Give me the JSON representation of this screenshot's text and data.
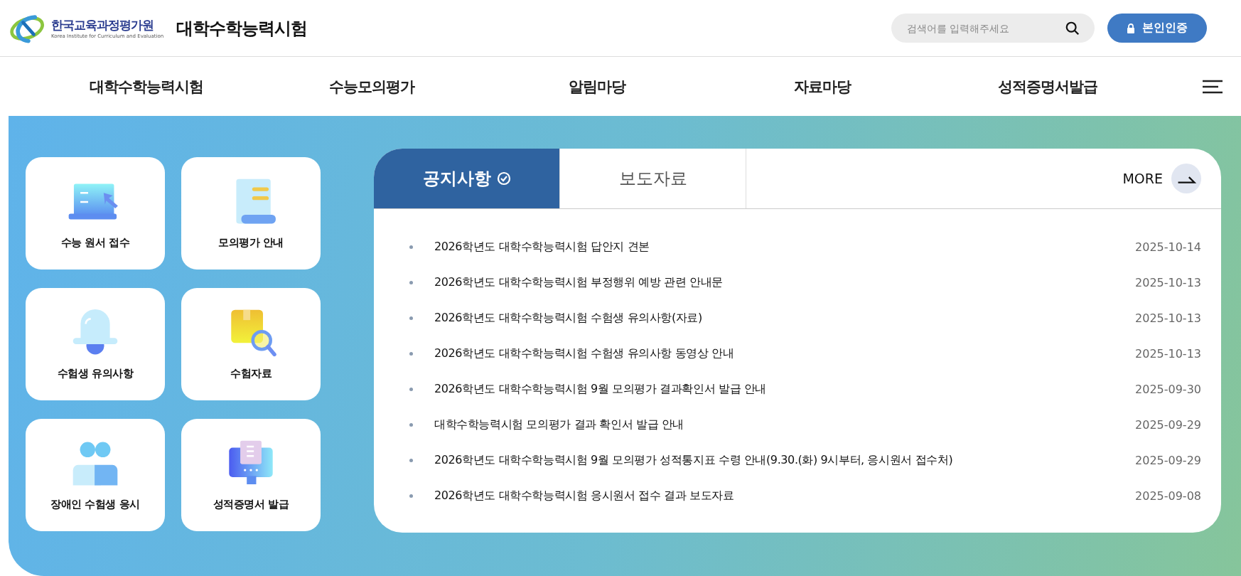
{
  "header": {
    "org_name": "한국교육과정평가원",
    "org_subtitle": "Korea Institute for Curriculum and Evaluation",
    "site_title": "대학수학능력시험",
    "search": {
      "placeholder": "검색어를 입력해주세요"
    },
    "auth_button": "본인인증"
  },
  "nav": [
    "대학수학능력시험",
    "수능모의평가",
    "알림마당",
    "자료마당",
    "성적증명서발급"
  ],
  "quick_links": [
    {
      "kind": "application",
      "label": "수능 원서 접수"
    },
    {
      "kind": "guide",
      "label": "모의평가 안내"
    },
    {
      "kind": "notice",
      "label": "수험생 유의사항"
    },
    {
      "kind": "materials",
      "label": "수험자료"
    },
    {
      "kind": "accessibility",
      "label": "장애인 수험생 응시"
    },
    {
      "kind": "certificate",
      "label": "성적증명서 발급"
    }
  ],
  "board": {
    "tabs": [
      {
        "label": "공지사항",
        "selected": true
      },
      {
        "label": "보도자료",
        "selected": false
      }
    ],
    "more": "MORE",
    "posts": [
      {
        "title": "2026학년도 대학수학능력시험 답안지 견본",
        "date": "2025-10-14"
      },
      {
        "title": "2026학년도 대학수학능력시험 부정행위 예방 관련 안내문",
        "date": "2025-10-13"
      },
      {
        "title": "2026학년도 대학수학능력시험 수험생 유의사항(자료)",
        "date": "2025-10-13"
      },
      {
        "title": "2026학년도 대학수학능력시험 수험생 유의사항 동영상 안내",
        "date": "2025-10-13"
      },
      {
        "title": "2026학년도 대학수학능력시험 9월 모의평가 결과확인서 발급 안내",
        "date": "2025-09-30"
      },
      {
        "title": "대학수학능력시험 모의평가 결과 확인서 발급 안내",
        "date": "2025-09-29"
      },
      {
        "title": "2026학년도 대학수학능력시험 9월 모의평가 성적통지표 수령 안내(9.30.(화) 9시부터, 응시원서 접수처)",
        "date": "2025-09-29"
      },
      {
        "title": "2026학년도 대학수학능력시험 응시원서 접수 결과 보도자료",
        "date": "2025-09-08"
      }
    ]
  }
}
